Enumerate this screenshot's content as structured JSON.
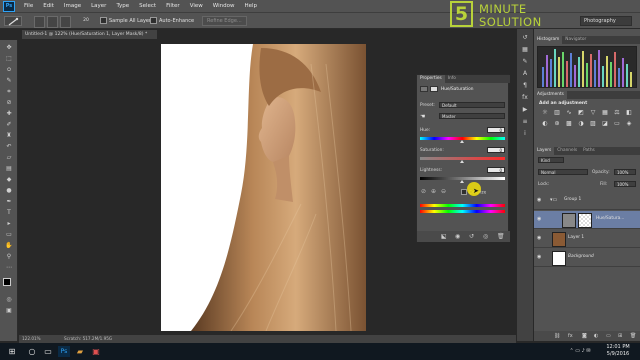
{
  "menubar": {
    "logo": "Ps",
    "items": [
      "File",
      "Edit",
      "Image",
      "Layer",
      "Type",
      "Select",
      "Filter",
      "View",
      "Window",
      "Help"
    ]
  },
  "options": {
    "brush_size": "20",
    "sample_all_layers": "Sample All Layers",
    "auto_enhance": "Auto-Enhance",
    "refine_edge": "Refine Edge...",
    "workspace": "Photography"
  },
  "brand": {
    "number": "5",
    "line1": "MINUTE",
    "line2": "SOLUTION",
    "color": "#b8d23a"
  },
  "document": {
    "tab_title": "Untitled-1 @ 122% (Hue/Saturation 1, Layer Mask/8) *",
    "zoom": "122.01%",
    "scratch": "Scratch: 517.2M/1.95G"
  },
  "properties": {
    "tabs": [
      "Properties",
      "Info"
    ],
    "title": "Hue/Saturation",
    "preset_label": "Preset:",
    "preset_value": "Default",
    "channel_value": "Master",
    "hue_label": "Hue:",
    "hue_value": "0",
    "saturation_label": "Saturation:",
    "saturation_value": "0",
    "lightness_label": "Lightness:",
    "lightness_value": "0",
    "colorize_label": "Colorize"
  },
  "right_panels": {
    "histogram_tabs": [
      "Histogram",
      "Navigator"
    ],
    "adjustments_tab": "Adjustments",
    "add_adjustment": "Add an adjustment",
    "layers_tabs": [
      "Layers",
      "Channels",
      "Paths"
    ],
    "kind": "Kind",
    "blend_mode": "Normal",
    "opacity_label": "Opacity:",
    "opacity_value": "100%",
    "lock_label": "Lock:",
    "fill_label": "Fill:",
    "fill_value": "100%",
    "layers": [
      {
        "name": "Group 1"
      },
      {
        "name": "Hue/Satura..."
      },
      {
        "name": "Layer 1"
      },
      {
        "name": "Background"
      }
    ]
  },
  "taskbar": {
    "time": "12:01 PM",
    "date": "5/9/2016"
  },
  "colors": {
    "panel": "#535353",
    "dark": "#282828",
    "accent": "#b8d23a",
    "hair": "#a9784c"
  }
}
